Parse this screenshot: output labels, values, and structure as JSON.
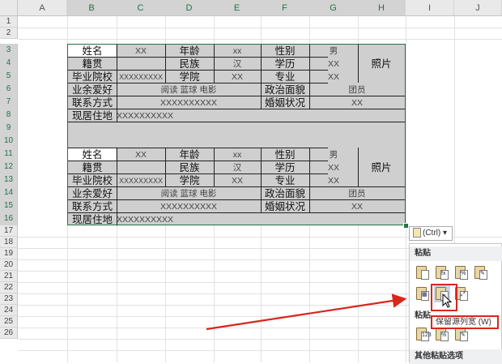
{
  "columns": [
    "A",
    "B",
    "C",
    "D",
    "E",
    "F",
    "G",
    "H",
    "I",
    "J"
  ],
  "rows": [
    "1",
    "2",
    "3",
    "4",
    "5",
    "6",
    "7",
    "8",
    "9",
    "10",
    "11",
    "12",
    "13",
    "14",
    "15",
    "16",
    "17",
    "18",
    "19",
    "20",
    "21",
    "22",
    "23",
    "24",
    "25",
    "26"
  ],
  "table": {
    "name_label": "姓名",
    "name_value": "XX",
    "age_label": "年龄",
    "age_value": "xx",
    "gender_label": "性别",
    "gender_value": "男",
    "photo": "照片",
    "origin_label": "籍贯",
    "nation_label": "民族",
    "nation_value": "汉",
    "edu_label": "学历",
    "edu_value": "XX",
    "school_label": "毕业院校",
    "school_value": "XXXXXXXXX",
    "college_label": "学院",
    "college_value": "XX",
    "major_label": "专业",
    "major_value": "XX",
    "hobby_label": "业余爱好",
    "hobby_value": "阅读 蓝球 电影",
    "politics_label": "政治面貌",
    "politics_value": "团员",
    "contact_label": "联系方式",
    "contact_value": "XXXXXXXXXX",
    "marital_label": "婚姻状况",
    "marital_value": "XX",
    "address_label": "现居住地",
    "address_value": "XXXXXXXXXX"
  },
  "paste_options": {
    "button_label": "(Ctrl)",
    "section_paste": "粘贴",
    "section_values": "粘贴",
    "section_other": "其他粘贴选项",
    "tooltip": "保留源列宽 (W)"
  }
}
